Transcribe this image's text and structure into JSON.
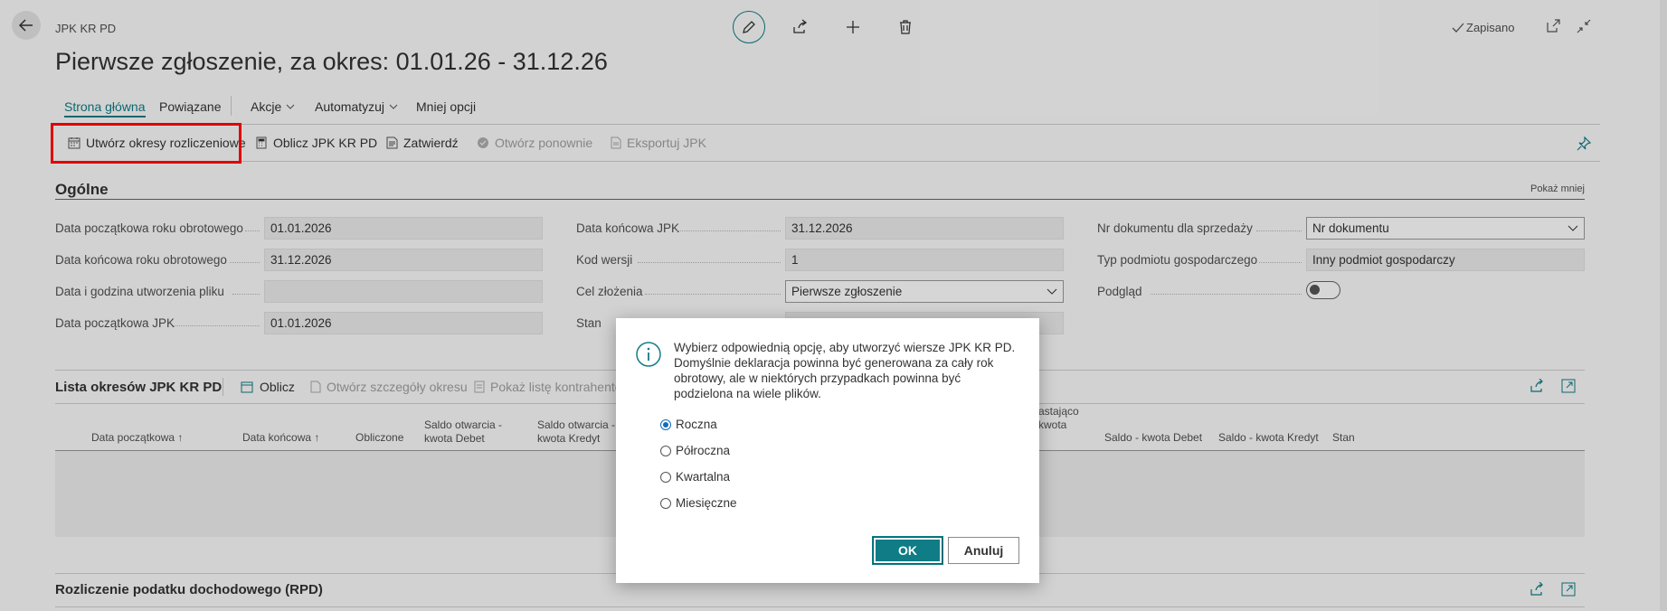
{
  "header": {
    "breadcrumb": "JPK KR PD",
    "title": "Pierwsze zgłoszenie, za okres: 01.01.26 - 31.12.26",
    "saved_status": "Zapisano"
  },
  "nav": {
    "items": [
      {
        "label": "Strona główna",
        "active": true
      },
      {
        "label": "Powiązane"
      },
      {
        "label": "Akcje"
      },
      {
        "label": "Automatyzuj"
      },
      {
        "label": "Mniej opcji"
      }
    ]
  },
  "actions": {
    "create_periods": "Utwórz okresy rozliczeniowe",
    "calculate": "Oblicz JPK KR PD",
    "approve": "Zatwierdź",
    "reopen": "Otwórz ponownie",
    "export": "Eksportuj JPK"
  },
  "general": {
    "title": "Ogólne",
    "show_less": "Pokaż mniej",
    "fields": {
      "fiscal_start_label": "Data początkowa roku obrotowego",
      "fiscal_start_value": "01.01.2026",
      "fiscal_end_label": "Data końcowa roku obrotowego",
      "fiscal_end_value": "31.12.2026",
      "created_label": "Data i godzina utworzenia pliku",
      "created_value": "",
      "jpk_start_label": "Data początkowa JPK",
      "jpk_start_value": "01.01.2026",
      "jpk_end_label": "Data końcowa JPK",
      "jpk_end_value": "31.12.2026",
      "version_label": "Kod wersji",
      "version_value": "1",
      "purpose_label": "Cel złożenia",
      "purpose_value": "Pierwsze zgłoszenie",
      "status_label": "Stan",
      "status_value": "",
      "doc_no_label": "Nr dokumentu dla sprzedaży",
      "doc_no_value": "Nr dokumentu",
      "entity_type_label": "Typ podmiotu gospodarczego",
      "entity_type_value": "Inny podmiot gospodarczy",
      "preview_label": "Podgląd",
      "preview_on": false
    }
  },
  "periods": {
    "title": "Lista okresów JPK KR PD",
    "calculate": "Oblicz",
    "open_details": "Otwórz szczegóły okresu",
    "show_contractors": "Pokaż listę kontrahentów",
    "columns": {
      "start": "Data początkowa ↑",
      "end": "Data końcowa ↑",
      "calculated": "Obliczone",
      "open_debit_1": "Saldo otwarcia -",
      "open_debit_2": "kwota Debet",
      "open_credit_1": "Saldo otwarcia -",
      "open_credit_2": "kwota Kredyt",
      "closing_1": "astająco",
      "closing_2": "kwota",
      "balance_debit": "Saldo - kwota Debet",
      "balance_credit": "Saldo - kwota Kredyt",
      "status": "Stan"
    }
  },
  "rpd": {
    "title": "Rozliczenie podatku dochodowego (RPD)"
  },
  "dialog": {
    "message": "Wybierz odpowiednią opcję, aby utworzyć wiersze JPK KR PD. Domyślnie deklaracja powinna być generowana za cały rok obrotowy, ale w niektórych przypadkach powinna być podzielona na wiele plików.",
    "options": [
      "Roczna",
      "Półroczna",
      "Kwartalna",
      "Miesięczne"
    ],
    "selected": "Roczna",
    "ok": "OK",
    "cancel": "Anuluj"
  },
  "colors": {
    "accent": "#0f7c86",
    "highlight": "#e00000"
  }
}
